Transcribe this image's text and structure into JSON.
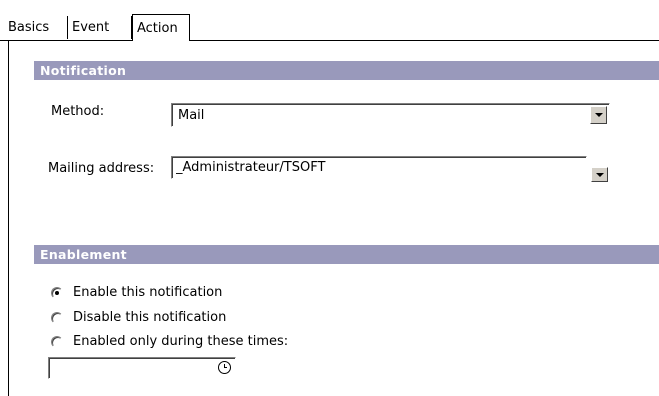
{
  "tabs": [
    {
      "label": "Basics"
    },
    {
      "label": "Event"
    },
    {
      "label": "Action"
    }
  ],
  "notification": {
    "header": "Notification",
    "method_label": "Method:",
    "method_value": "Mail",
    "mailing_label": "Mailing address:",
    "mailing_value": "_Administrateur/TSOFT"
  },
  "enablement": {
    "header": "Enablement",
    "options": [
      {
        "label": "Enable this notification",
        "checked": true
      },
      {
        "label": "Disable this notification",
        "checked": false
      },
      {
        "label": "Enabled only during these times:",
        "checked": false
      }
    ],
    "time_value": ""
  },
  "icons": {
    "dropdown": "chevron-down-icon",
    "clock": "clock-icon"
  }
}
